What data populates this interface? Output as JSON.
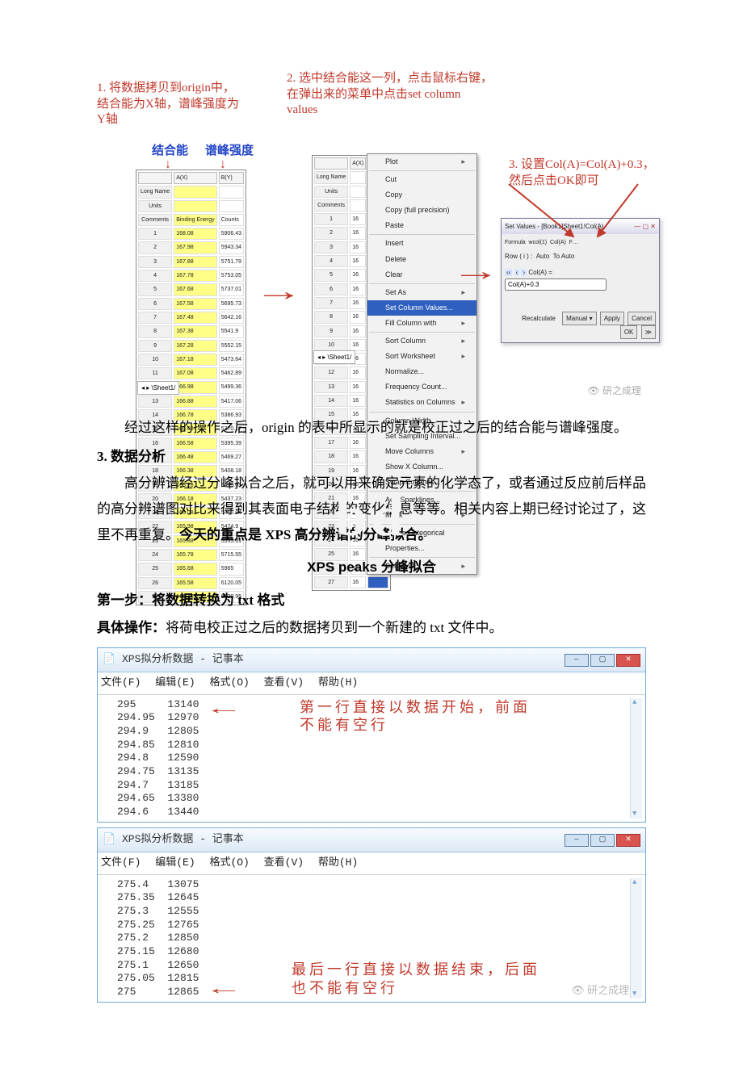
{
  "figTop": {
    "anno1": "1. 将数据拷贝到origin中，\n结合能为X轴，谱峰强度为\nY轴",
    "anno2": "2. 选中结合能这一列，点击鼠标右键，\n在弹出来的菜单中点击set column\nvalues",
    "anno3": "3. 设置Col(A)=Col(A)+0.3，\n然后点击OK即可",
    "lblBindCn": "结合能",
    "lblPeakCn": "谱峰强度",
    "sheetTab": "Sheet1",
    "colA": "A(X)",
    "colB": "B(Y)",
    "longName": "Long Name",
    "units": "Units",
    "comments": "Comments",
    "bindingEnergy": "Binding Energy",
    "counts": "Counts",
    "rows1": [
      [
        "1",
        "168.08",
        "5906.43"
      ],
      [
        "2",
        "167.98",
        "5943.34"
      ],
      [
        "3",
        "167.88",
        "5751.79"
      ],
      [
        "4",
        "167.78",
        "5753.05"
      ],
      [
        "5",
        "167.68",
        "5737.01"
      ],
      [
        "6",
        "167.58",
        "5695.73"
      ],
      [
        "7",
        "167.48",
        "5642.16"
      ],
      [
        "8",
        "167.38",
        "5541.9"
      ],
      [
        "9",
        "167.28",
        "5552.15"
      ],
      [
        "10",
        "167.18",
        "5473.64"
      ],
      [
        "11",
        "167.08",
        "5462.89"
      ],
      [
        "12",
        "166.98",
        "5499.36"
      ],
      [
        "13",
        "166.88",
        "5417.06"
      ],
      [
        "14",
        "166.78",
        "5386.93"
      ],
      [
        "15",
        "166.68",
        "5370.17"
      ],
      [
        "16",
        "166.58",
        "5395.39"
      ],
      [
        "17",
        "166.48",
        "5469.27"
      ],
      [
        "18",
        "166.38",
        "5408.18"
      ],
      [
        "19",
        "166.28",
        "5429.05"
      ],
      [
        "20",
        "166.18",
        "5437.23"
      ],
      [
        "21",
        "166.08",
        "5450.84"
      ],
      [
        "22",
        "165.98",
        "5474.9"
      ],
      [
        "23",
        "165.88",
        "5555.31"
      ],
      [
        "24",
        "165.78",
        "5715.55"
      ],
      [
        "25",
        "165.68",
        "5965"
      ],
      [
        "26",
        "165.58",
        "6120.05"
      ],
      [
        "27",
        "165.48",
        "6529.95"
      ]
    ],
    "bcol": "B(Y)",
    "rows2": [
      [
        "1",
        "16"
      ],
      [
        "2",
        "16"
      ],
      [
        "3",
        "16"
      ],
      [
        "4",
        "16"
      ],
      [
        "5",
        "16"
      ],
      [
        "6",
        "16"
      ],
      [
        "7",
        "16"
      ],
      [
        "8",
        "16"
      ],
      [
        "9",
        "16"
      ],
      [
        "10",
        "16"
      ],
      [
        "11",
        "16"
      ],
      [
        "12",
        "16"
      ],
      [
        "13",
        "16"
      ],
      [
        "14",
        "16"
      ],
      [
        "15",
        "16"
      ],
      [
        "16",
        "16"
      ],
      [
        "17",
        "16"
      ],
      [
        "18",
        "16"
      ],
      [
        "19",
        "16"
      ],
      [
        "20",
        "16"
      ],
      [
        "21",
        "16"
      ],
      [
        "22",
        "16"
      ],
      [
        "23",
        "16"
      ],
      [
        "24",
        "16"
      ],
      [
        "25",
        "16"
      ],
      [
        "26",
        "16"
      ],
      [
        "27",
        "16"
      ]
    ],
    "ctx": {
      "plot": "Plot",
      "cut": "Cut",
      "copy": "Copy",
      "copyFull": "Copy (full precision)",
      "paste": "Paste",
      "insert": "Insert",
      "delete": "Delete",
      "clear": "Clear",
      "setAs": "Set As",
      "setCol": "Set Column Values...",
      "fill": "Fill Column with",
      "sortCol": "Sort Column",
      "sortWs": "Sort Worksheet",
      "norm": "Normalize...",
      "freq": "Frequency Count...",
      "stats": "Statistics on Columns",
      "colWidth": "Column Width...",
      "sampInt": "Set Sampling Interval...",
      "moveCols": "Move Columns",
      "showX": "Show X Column...",
      "swap": "Swap Columns...",
      "spark": "Add Sparklines...",
      "mask": "Mask",
      "cat": "Set as Categorical",
      "props": "Properties...",
      "style": "Set Style"
    },
    "dlg": {
      "title": "Set Values - [Book1]Sheet1!Col(A)",
      "rowLabel": "Row ( i ) :",
      "from": "Auto",
      "to": "To  Auto",
      "formulaLbl": "Col(A) =",
      "formula": "Col(A)+0.3",
      "recalc": "Recalculate",
      "mode": "Manual ▾",
      "apply": "Apply",
      "cancel": "Cancel",
      "ok": "OK"
    },
    "watermark": "研之成理"
  },
  "body": {
    "para1": "经过这样的操作之后，origin 的表中所显示的就是校正过之后的结合能与谱峰强度。",
    "sec3Label": "3.  数据分析",
    "para2a": "高分辨谱经过分峰拟合之后，就可以用来确定元素的化学态了，或者通过反应前后样品的高分辨谱图对比来得到其表面电子结构的变化信息等等。相关内容上期已经讨论过了，这里不再重复。",
    "para2bBold": "今天的重点是 XPS 高分辨谱的分峰拟合。",
    "h3": "XPS peaks 分峰拟合",
    "step1": "第一步：将数据转换为 txt 格式",
    "step1bBold": "具体操作：",
    "step1bRest": "将荷电校正过之后的数据拷贝到一个新建的 txt 文件中。"
  },
  "notepad": {
    "title": "XPS拟分析数据 - 记事本",
    "menus": {
      "file": "文件(F)",
      "edit": "编辑(E)",
      "format": "格式(O)",
      "view": "查看(V)",
      "help": "帮助(H)"
    },
    "data1": [
      [
        "295",
        "13140"
      ],
      [
        "294.95",
        "12970"
      ],
      [
        "294.9",
        "12805"
      ],
      [
        "294.85",
        "12810"
      ],
      [
        "294.8",
        "12590"
      ],
      [
        "294.75",
        "13135"
      ],
      [
        "294.7",
        "13185"
      ],
      [
        "294.65",
        "13380"
      ],
      [
        "294.6",
        "13440"
      ]
    ],
    "anno1": "第一行直接以数据开始，前面\n不能有空行",
    "data2": [
      [
        "275.4",
        "13075"
      ],
      [
        "275.35",
        "12645"
      ],
      [
        "275.3",
        "12555"
      ],
      [
        "275.25",
        "12765"
      ],
      [
        "275.2",
        "12850"
      ],
      [
        "275.15",
        "12680"
      ],
      [
        "275.1",
        "12650"
      ],
      [
        "275.05",
        "12815"
      ],
      [
        "275",
        "12865"
      ]
    ],
    "anno2": "最后一行直接以数据结束，后面\n也不能有空行",
    "watermark": "研之成理"
  }
}
